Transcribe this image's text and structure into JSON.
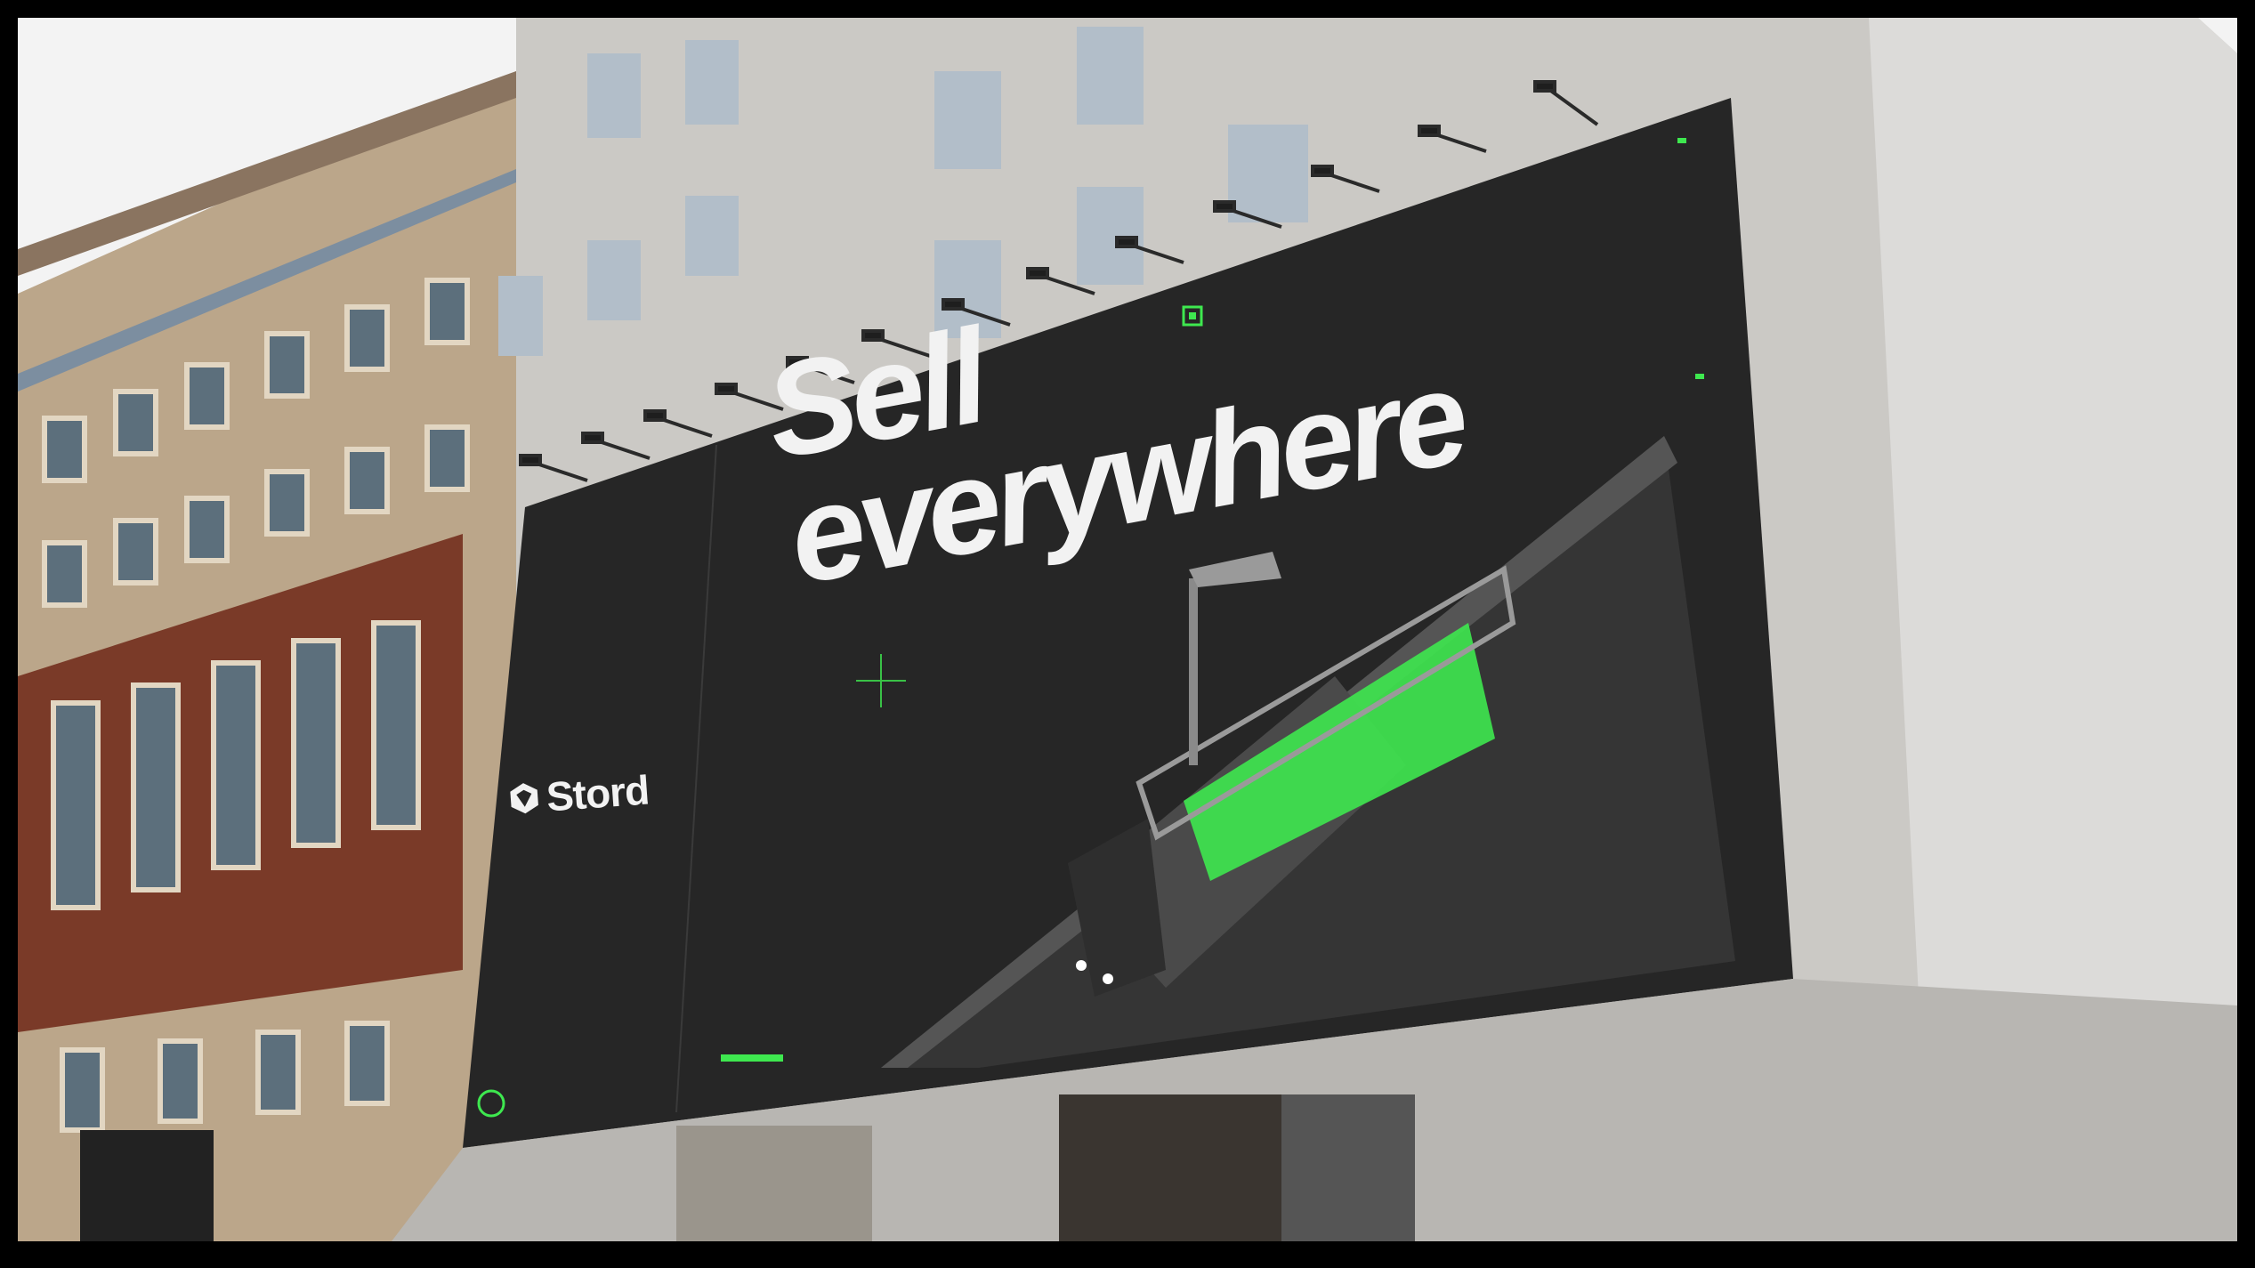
{
  "billboard": {
    "headline_line1": "Sell",
    "headline_line2": "everywhere",
    "brand": "Stord",
    "brand_icon": "stord-hexagon-logo-icon",
    "colors": {
      "billboard": "#262626",
      "accent_green": "#3ee84f",
      "headline": "#f2f2f2"
    }
  },
  "scene": {
    "subject": "outdoor billboard on building facade",
    "building_left_color": "#b9a58c",
    "building_right_color": "#c9c7c3",
    "sky_color": "#f4f4f4"
  }
}
